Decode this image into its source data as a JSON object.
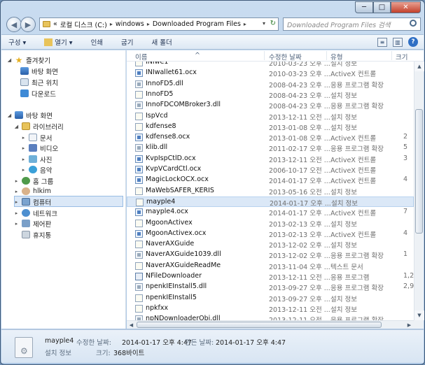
{
  "window": {
    "controls": {
      "minimize": "─",
      "maximize": "□",
      "close": "✕"
    }
  },
  "address": {
    "prefix": "«",
    "crumbs": [
      "로컬 디스크 (C:)",
      "windows",
      "Downloaded Program Files"
    ],
    "separator": "▸",
    "dropdown": "▾",
    "refresh": "↻"
  },
  "search": {
    "placeholder": "Downloaded Program Files 검색"
  },
  "toolbar": {
    "organize": "구성 ▾",
    "open": "열기 ▾",
    "print": "인쇄",
    "burn": "굽기",
    "new_folder": "새 폴더",
    "view_icon": "≡",
    "pane_icon": "▥",
    "help": "?"
  },
  "nav": {
    "favorites": "즐겨찾기",
    "desktop_fav": "바탕 화면",
    "recent": "최근 위치",
    "downloads": "다운로드",
    "desktop": "바탕 화면",
    "libraries": "라이브러리",
    "documents": "문서",
    "videos": "비디오",
    "pictures": "사진",
    "music": "음악",
    "homegroup": "홈 그룹",
    "user": "hlkim",
    "computer": "컴퓨터",
    "network": "네트워크",
    "control_panel": "제어판",
    "recycle_bin": "휴지통",
    "expand": "▸",
    "collapse": "◢"
  },
  "columns": {
    "name": "이름",
    "date": "수정한 날짜",
    "type": "유형",
    "size": "크기",
    "sort": "^"
  },
  "files": [
    {
      "name": "INIwe1",
      "date": "2010-03-23 오후 ...",
      "type": "설치 정보",
      "size": "",
      "kind": "inf"
    },
    {
      "name": "INIwallet61.ocx",
      "date": "2010-03-23 오후 ...",
      "type": "ActiveX 컨트롤",
      "size": "",
      "kind": "ocx"
    },
    {
      "name": "InnoFD5.dll",
      "date": "2008-04-23 오후 ...",
      "type": "응용 프로그램 확장",
      "size": "",
      "kind": "dll"
    },
    {
      "name": "InnoFD5",
      "date": "2008-04-23 오후 ...",
      "type": "설치 정보",
      "size": "",
      "kind": "inf"
    },
    {
      "name": "InnoFDCOMBroker3.dll",
      "date": "2008-04-23 오후 ...",
      "type": "응용 프로그램 확장",
      "size": "",
      "kind": "dll"
    },
    {
      "name": "IspVcd",
      "date": "2013-12-11 오전 ...",
      "type": "설치 정보",
      "size": "",
      "kind": "inf"
    },
    {
      "name": "kdfense8",
      "date": "2013-01-08 오후 ...",
      "type": "설치 정보",
      "size": "",
      "kind": "inf"
    },
    {
      "name": "kdfense8.ocx",
      "date": "2013-01-08 오후 ...",
      "type": "ActiveX 컨트롤",
      "size": "2",
      "kind": "ocx"
    },
    {
      "name": "klib.dll",
      "date": "2011-02-17 오후 ...",
      "type": "응용 프로그램 확장",
      "size": "5",
      "kind": "dll"
    },
    {
      "name": "KvpIspCtlD.ocx",
      "date": "2013-12-11 오전 ...",
      "type": "ActiveX 컨트롤",
      "size": "3",
      "kind": "ocx"
    },
    {
      "name": "KvpVCardCtl.ocx",
      "date": "2006-10-17 오전 ...",
      "type": "ActiveX 컨트롤",
      "size": "",
      "kind": "ocx"
    },
    {
      "name": "MagicLockOCX.ocx",
      "date": "2014-01-17 오후 ...",
      "type": "ActiveX 컨트롤",
      "size": "4",
      "kind": "ocx"
    },
    {
      "name": "MaWebSAFER_KERIS",
      "date": "2013-05-16 오전 ...",
      "type": "설치 정보",
      "size": "",
      "kind": "inf"
    },
    {
      "name": "mayple4",
      "date": "2014-01-17 오후 ...",
      "type": "설치 정보",
      "size": "",
      "kind": "inf",
      "selected": true
    },
    {
      "name": "mayple4.ocx",
      "date": "2014-01-17 오후 ...",
      "type": "ActiveX 컨트롤",
      "size": "7",
      "kind": "ocx"
    },
    {
      "name": "MgoonActivex",
      "date": "2013-02-13 오후 ...",
      "type": "설치 정보",
      "size": "",
      "kind": "inf"
    },
    {
      "name": "MgoonActivex.ocx",
      "date": "2013-02-13 오후 ...",
      "type": "ActiveX 컨트롤",
      "size": "4",
      "kind": "ocx"
    },
    {
      "name": "NaverAXGuide",
      "date": "2013-12-02 오후 ...",
      "type": "설치 정보",
      "size": "",
      "kind": "inf"
    },
    {
      "name": "NaverAXGuide1039.dll",
      "date": "2013-12-02 오후 ...",
      "type": "응용 프로그램 확장",
      "size": "1",
      "kind": "dll"
    },
    {
      "name": "NaverAXGuideReadMe",
      "date": "2013-11-04 오후 ...",
      "type": "텍스트 문서",
      "size": "",
      "kind": "inf"
    },
    {
      "name": "NFileDownloader",
      "date": "2013-12-11 오전 ...",
      "type": "응용 프로그램",
      "size": "1,2",
      "kind": "exe"
    },
    {
      "name": "npenkIEInstall5.dll",
      "date": "2013-09-27 오후 ...",
      "type": "응용 프로그램 확장",
      "size": "2,9",
      "kind": "dll"
    },
    {
      "name": "npenkIEInstall5",
      "date": "2013-09-27 오후 ...",
      "type": "설치 정보",
      "size": "",
      "kind": "inf"
    },
    {
      "name": "npkfxx",
      "date": "2013-12-11 오전 ...",
      "type": "설치 정보",
      "size": "",
      "kind": "inf"
    },
    {
      "name": "npNDownloaderObj.dll",
      "date": "2013-12-11 오전 ...",
      "type": "응용 프로그램 확장",
      "size": "",
      "kind": "dll"
    }
  ],
  "details": {
    "name": "mayple4",
    "type": "설치 정보",
    "modified_label": "수정한 날짜:",
    "modified_value": "2014-01-17 오후 4:47",
    "created_label": "만든 날짜:",
    "created_value": "2014-01-17 오후 4:47",
    "size_label": "크기:",
    "size_value": "368바이트"
  },
  "scroll": {
    "up": "▲",
    "down": "▼",
    "left": "◀",
    "right": "▶"
  }
}
